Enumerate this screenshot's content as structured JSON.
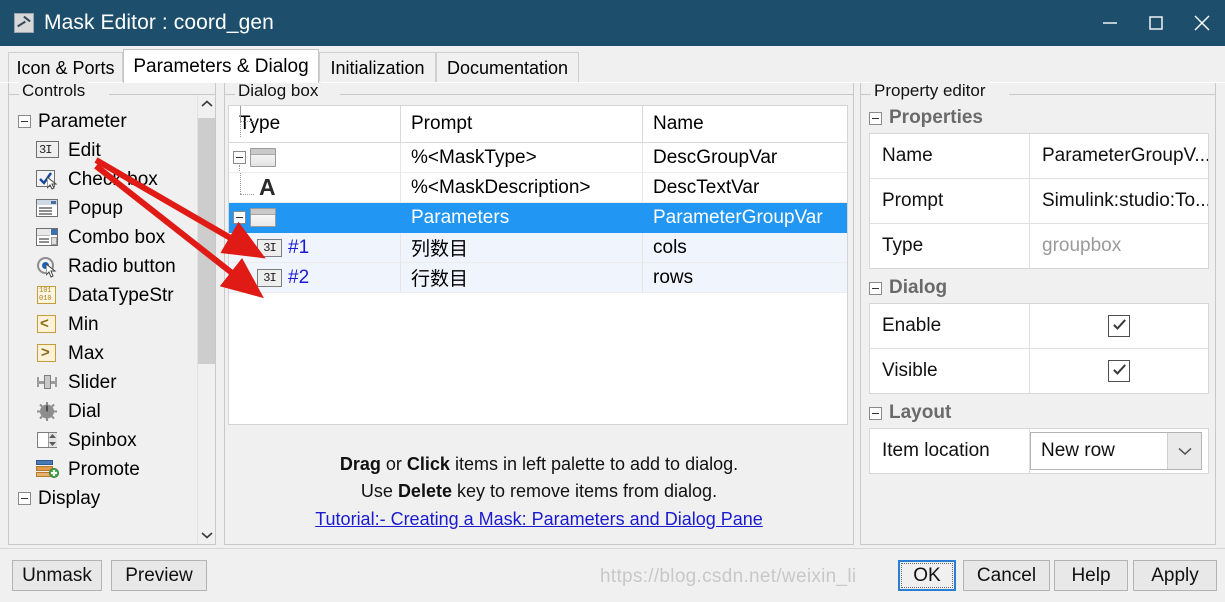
{
  "window": {
    "title": "Mask Editor : coord_gen",
    "icon": "mask-editor-icon",
    "buttons": {
      "minimize": "minimize-icon",
      "maximize": "maximize-icon",
      "close": "close-icon"
    },
    "titlebar_color": "#1d4f6c"
  },
  "tabs": [
    {
      "label": "Icon & Ports",
      "active": false
    },
    {
      "label": "Parameters & Dialog",
      "active": true
    },
    {
      "label": "Initialization",
      "active": false
    },
    {
      "label": "Documentation",
      "active": false
    }
  ],
  "palette": {
    "legend": "Controls",
    "groups": [
      {
        "label": "Parameter",
        "expanded": true,
        "items": [
          {
            "label": "Edit",
            "icon": "edit-field-icon"
          },
          {
            "label": "Check box",
            "icon": "checkbox-icon"
          },
          {
            "label": "Popup",
            "icon": "popup-list-icon"
          },
          {
            "label": "Combo box",
            "icon": "combo-box-icon"
          },
          {
            "label": "Radio button",
            "icon": "radio-button-icon"
          },
          {
            "label": "DataTypeStr",
            "icon": "datatype-string-icon"
          },
          {
            "label": "Min",
            "icon": "min-icon"
          },
          {
            "label": "Max",
            "icon": "max-icon"
          },
          {
            "label": "Slider",
            "icon": "slider-icon"
          },
          {
            "label": "Dial",
            "icon": "dial-icon"
          },
          {
            "label": "Spinbox",
            "icon": "spinbox-icon"
          },
          {
            "label": "Promote",
            "icon": "promote-icon"
          }
        ]
      },
      {
        "label": "Display",
        "expanded": true,
        "items": []
      }
    ]
  },
  "dialog_box": {
    "legend": "Dialog box",
    "columns": [
      "Type",
      "Prompt",
      "Name"
    ],
    "rows": [
      {
        "type_glyph": "groupbox",
        "index": "",
        "depth": 0,
        "prompt": "%<MaskType>",
        "name": "DescGroupVar",
        "selected": false
      },
      {
        "type_glyph": "text",
        "index": "",
        "depth": 1,
        "prompt": "%<MaskDescription>",
        "name": "DescTextVar",
        "selected": false
      },
      {
        "type_glyph": "groupbox",
        "index": "",
        "depth": 0,
        "prompt": "Parameters",
        "name": "ParameterGroupVar",
        "selected": true
      },
      {
        "type_glyph": "edit",
        "index": "#1",
        "depth": 1,
        "prompt": "列数目",
        "name": "cols",
        "selected": false
      },
      {
        "type_glyph": "edit",
        "index": "#2",
        "depth": 1,
        "prompt": "行数目",
        "name": "rows",
        "selected": false
      }
    ],
    "hints": [
      [
        {
          "t": "Drag",
          "b": true
        },
        {
          "t": " or ",
          "b": false
        },
        {
          "t": "Click",
          "b": true
        },
        {
          "t": " items in left palette to add to dialog.",
          "b": false
        }
      ],
      [
        {
          "t": "Use ",
          "b": false
        },
        {
          "t": "Delete",
          "b": true
        },
        {
          "t": " key to remove items from dialog.",
          "b": false
        }
      ]
    ],
    "tutorial_link": "Tutorial:- Creating a Mask: Parameters and Dialog Pane"
  },
  "property_editor": {
    "legend": "Property editor",
    "sections": [
      {
        "label": "Properties",
        "rows": [
          {
            "key": "Name",
            "value": "ParameterGroupV...",
            "kind": "text"
          },
          {
            "key": "Prompt",
            "value": "Simulink:studio:To...",
            "kind": "text"
          },
          {
            "key": "Type",
            "value": "groupbox",
            "kind": "readonly"
          }
        ]
      },
      {
        "label": "Dialog",
        "rows": [
          {
            "key": "Enable",
            "value": "checked",
            "kind": "checkbox"
          },
          {
            "key": "Visible",
            "value": "checked",
            "kind": "checkbox"
          }
        ]
      },
      {
        "label": "Layout",
        "rows": [
          {
            "key": "Item location",
            "value": "New row",
            "kind": "select"
          }
        ]
      }
    ]
  },
  "footer": {
    "left_buttons": [
      {
        "label": "Unmask"
      },
      {
        "label": "Preview"
      }
    ],
    "right_buttons": [
      {
        "label": "OK",
        "primary": true
      },
      {
        "label": "Cancel",
        "primary": false
      },
      {
        "label": "Help",
        "primary": false
      },
      {
        "label": "Apply",
        "primary": false
      }
    ]
  },
  "watermark": "https://blog.csdn.net/weixin_li"
}
